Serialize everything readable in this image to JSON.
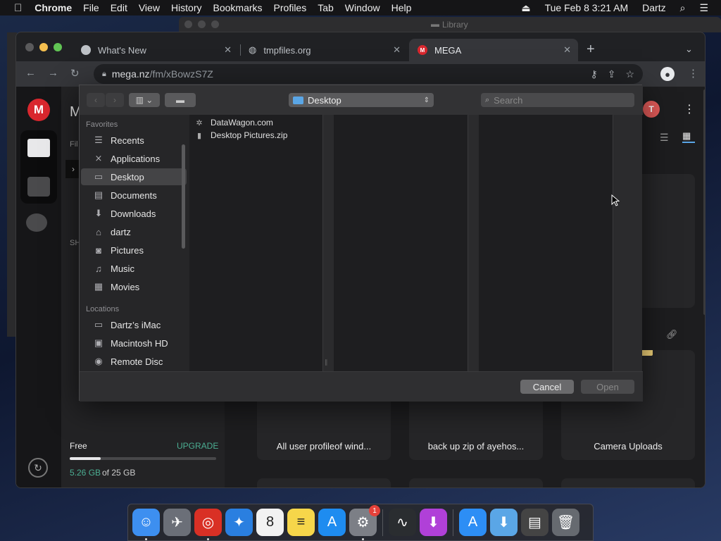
{
  "menubar": {
    "app": "Chrome",
    "items": [
      "File",
      "Edit",
      "View",
      "History",
      "Bookmarks",
      "Profiles",
      "Tab",
      "Window",
      "Help"
    ],
    "clock": "Tue Feb 8  3:21 AM",
    "user": "Dartz"
  },
  "background_window": {
    "title": "Library"
  },
  "browser": {
    "tabs": [
      {
        "title": "What's New",
        "active": false
      },
      {
        "title": "tmpfiles.org",
        "active": false
      },
      {
        "title": "MEGA",
        "active": true
      }
    ],
    "url_host": "mega.nz",
    "url_path": "/fm/xBowzS7Z"
  },
  "mega": {
    "logo": "M",
    "avatar_initial": "T",
    "header_partial": "M",
    "label_fi": "Fil",
    "label_sh": "SH",
    "storage": {
      "plan": "Free",
      "upgrade": "UPGRADE",
      "used": "5.26 GB",
      "of_total": "of 25 GB",
      "used_fraction": 0.21
    },
    "folders": [
      "All user profileof wind...",
      "back up zip of ayehos...",
      "Camera Uploads"
    ]
  },
  "dialog": {
    "location": "Desktop",
    "search_placeholder": "Search",
    "favorites_header": "Favorites",
    "favorites": [
      {
        "label": "Recents",
        "icon": "clock-icon",
        "glyph": "☰"
      },
      {
        "label": "Applications",
        "icon": "applications-icon",
        "glyph": "⨯"
      },
      {
        "label": "Desktop",
        "icon": "desktop-icon",
        "glyph": "▭",
        "selected": true
      },
      {
        "label": "Documents",
        "icon": "document-icon",
        "glyph": "▤"
      },
      {
        "label": "Downloads",
        "icon": "download-icon",
        "glyph": "⬇"
      },
      {
        "label": "dartz",
        "icon": "home-icon",
        "glyph": "⌂"
      },
      {
        "label": "Pictures",
        "icon": "camera-icon",
        "glyph": "◙"
      },
      {
        "label": "Music",
        "icon": "music-icon",
        "glyph": "♫"
      },
      {
        "label": "Movies",
        "icon": "film-icon",
        "glyph": "▦"
      }
    ],
    "locations_header": "Locations",
    "locations": [
      {
        "label": "Dartz’s iMac",
        "icon": "imac-icon",
        "glyph": "▭"
      },
      {
        "label": "Macintosh HD",
        "icon": "harddisk-icon",
        "glyph": "▣"
      },
      {
        "label": "Remote Disc",
        "icon": "disc-icon",
        "glyph": "◉"
      }
    ],
    "files": [
      {
        "name": "DataWagon.com",
        "icon": "gear-file-icon",
        "glyph": "✲"
      },
      {
        "name": "Desktop Pictures.zip",
        "icon": "zip-file-icon",
        "glyph": "▮"
      }
    ],
    "cancel": "Cancel",
    "open": "Open"
  },
  "dock": {
    "apps": [
      {
        "name": "finder-icon",
        "glyph": "☺",
        "color": "#3d8ff0",
        "running": true
      },
      {
        "name": "launchpad-icon",
        "glyph": "✈",
        "color": "#6b6f78",
        "running": false
      },
      {
        "name": "chrome-icon",
        "glyph": "◎",
        "color": "#d93025",
        "running": true
      },
      {
        "name": "safari-icon",
        "glyph": "✦",
        "color": "#2a7fe0",
        "running": false
      },
      {
        "name": "calendar-icon",
        "glyph": "8",
        "color": "#f2f2f2",
        "running": false
      },
      {
        "name": "notes-icon",
        "glyph": "≡",
        "color": "#f6d64a",
        "running": false
      },
      {
        "name": "appstore-icon",
        "glyph": "A",
        "color": "#1e8cf0",
        "running": false
      },
      {
        "name": "system-preferences-icon",
        "glyph": "⚙",
        "color": "#7c7f86",
        "running": true,
        "badge": "1"
      },
      {
        "name": "activity-monitor-icon",
        "glyph": "∿",
        "color": "#2a2d30",
        "running": false,
        "sep_before": true
      },
      {
        "name": "installer-icon",
        "glyph": "⬇",
        "color": "#b040d8",
        "running": false
      },
      {
        "name": "applications-folder-icon",
        "glyph": "A",
        "color": "#2d8ef5",
        "running": false,
        "sep_before": true
      },
      {
        "name": "downloads-folder-icon",
        "glyph": "⬇",
        "color": "#5aa6e6",
        "running": false
      },
      {
        "name": "documents-stack-icon",
        "glyph": "▤",
        "color": "#444",
        "running": false
      },
      {
        "name": "trash-icon",
        "glyph": "🗑",
        "color": "#666a70",
        "running": false
      }
    ]
  },
  "colors": {
    "mega_red": "#d9272e",
    "upgrade_green": "#4caf93",
    "folder_yellow": "#f4d57a"
  }
}
